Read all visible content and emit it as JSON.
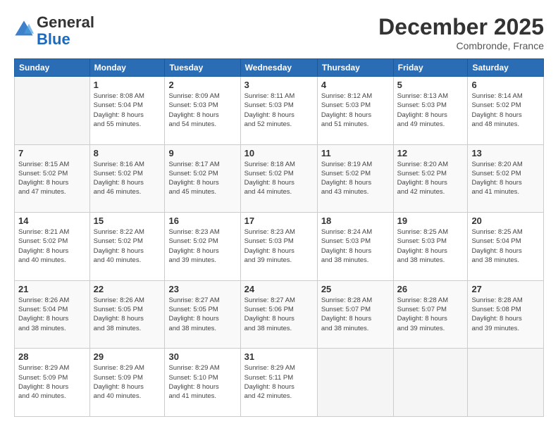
{
  "header": {
    "logo_line1": "General",
    "logo_line2": "Blue",
    "month": "December 2025",
    "location": "Combronde, France"
  },
  "days_of_week": [
    "Sunday",
    "Monday",
    "Tuesday",
    "Wednesday",
    "Thursday",
    "Friday",
    "Saturday"
  ],
  "weeks": [
    [
      {
        "day": "",
        "info": ""
      },
      {
        "day": "1",
        "info": "Sunrise: 8:08 AM\nSunset: 5:04 PM\nDaylight: 8 hours\nand 55 minutes."
      },
      {
        "day": "2",
        "info": "Sunrise: 8:09 AM\nSunset: 5:03 PM\nDaylight: 8 hours\nand 54 minutes."
      },
      {
        "day": "3",
        "info": "Sunrise: 8:11 AM\nSunset: 5:03 PM\nDaylight: 8 hours\nand 52 minutes."
      },
      {
        "day": "4",
        "info": "Sunrise: 8:12 AM\nSunset: 5:03 PM\nDaylight: 8 hours\nand 51 minutes."
      },
      {
        "day": "5",
        "info": "Sunrise: 8:13 AM\nSunset: 5:03 PM\nDaylight: 8 hours\nand 49 minutes."
      },
      {
        "day": "6",
        "info": "Sunrise: 8:14 AM\nSunset: 5:02 PM\nDaylight: 8 hours\nand 48 minutes."
      }
    ],
    [
      {
        "day": "7",
        "info": "Sunrise: 8:15 AM\nSunset: 5:02 PM\nDaylight: 8 hours\nand 47 minutes."
      },
      {
        "day": "8",
        "info": "Sunrise: 8:16 AM\nSunset: 5:02 PM\nDaylight: 8 hours\nand 46 minutes."
      },
      {
        "day": "9",
        "info": "Sunrise: 8:17 AM\nSunset: 5:02 PM\nDaylight: 8 hours\nand 45 minutes."
      },
      {
        "day": "10",
        "info": "Sunrise: 8:18 AM\nSunset: 5:02 PM\nDaylight: 8 hours\nand 44 minutes."
      },
      {
        "day": "11",
        "info": "Sunrise: 8:19 AM\nSunset: 5:02 PM\nDaylight: 8 hours\nand 43 minutes."
      },
      {
        "day": "12",
        "info": "Sunrise: 8:20 AM\nSunset: 5:02 PM\nDaylight: 8 hours\nand 42 minutes."
      },
      {
        "day": "13",
        "info": "Sunrise: 8:20 AM\nSunset: 5:02 PM\nDaylight: 8 hours\nand 41 minutes."
      }
    ],
    [
      {
        "day": "14",
        "info": "Sunrise: 8:21 AM\nSunset: 5:02 PM\nDaylight: 8 hours\nand 40 minutes."
      },
      {
        "day": "15",
        "info": "Sunrise: 8:22 AM\nSunset: 5:02 PM\nDaylight: 8 hours\nand 40 minutes."
      },
      {
        "day": "16",
        "info": "Sunrise: 8:23 AM\nSunset: 5:02 PM\nDaylight: 8 hours\nand 39 minutes."
      },
      {
        "day": "17",
        "info": "Sunrise: 8:23 AM\nSunset: 5:03 PM\nDaylight: 8 hours\nand 39 minutes."
      },
      {
        "day": "18",
        "info": "Sunrise: 8:24 AM\nSunset: 5:03 PM\nDaylight: 8 hours\nand 38 minutes."
      },
      {
        "day": "19",
        "info": "Sunrise: 8:25 AM\nSunset: 5:03 PM\nDaylight: 8 hours\nand 38 minutes."
      },
      {
        "day": "20",
        "info": "Sunrise: 8:25 AM\nSunset: 5:04 PM\nDaylight: 8 hours\nand 38 minutes."
      }
    ],
    [
      {
        "day": "21",
        "info": "Sunrise: 8:26 AM\nSunset: 5:04 PM\nDaylight: 8 hours\nand 38 minutes."
      },
      {
        "day": "22",
        "info": "Sunrise: 8:26 AM\nSunset: 5:05 PM\nDaylight: 8 hours\nand 38 minutes."
      },
      {
        "day": "23",
        "info": "Sunrise: 8:27 AM\nSunset: 5:05 PM\nDaylight: 8 hours\nand 38 minutes."
      },
      {
        "day": "24",
        "info": "Sunrise: 8:27 AM\nSunset: 5:06 PM\nDaylight: 8 hours\nand 38 minutes."
      },
      {
        "day": "25",
        "info": "Sunrise: 8:28 AM\nSunset: 5:07 PM\nDaylight: 8 hours\nand 38 minutes."
      },
      {
        "day": "26",
        "info": "Sunrise: 8:28 AM\nSunset: 5:07 PM\nDaylight: 8 hours\nand 39 minutes."
      },
      {
        "day": "27",
        "info": "Sunrise: 8:28 AM\nSunset: 5:08 PM\nDaylight: 8 hours\nand 39 minutes."
      }
    ],
    [
      {
        "day": "28",
        "info": "Sunrise: 8:29 AM\nSunset: 5:09 PM\nDaylight: 8 hours\nand 40 minutes."
      },
      {
        "day": "29",
        "info": "Sunrise: 8:29 AM\nSunset: 5:09 PM\nDaylight: 8 hours\nand 40 minutes."
      },
      {
        "day": "30",
        "info": "Sunrise: 8:29 AM\nSunset: 5:10 PM\nDaylight: 8 hours\nand 41 minutes."
      },
      {
        "day": "31",
        "info": "Sunrise: 8:29 AM\nSunset: 5:11 PM\nDaylight: 8 hours\nand 42 minutes."
      },
      {
        "day": "",
        "info": ""
      },
      {
        "day": "",
        "info": ""
      },
      {
        "day": "",
        "info": ""
      }
    ]
  ]
}
